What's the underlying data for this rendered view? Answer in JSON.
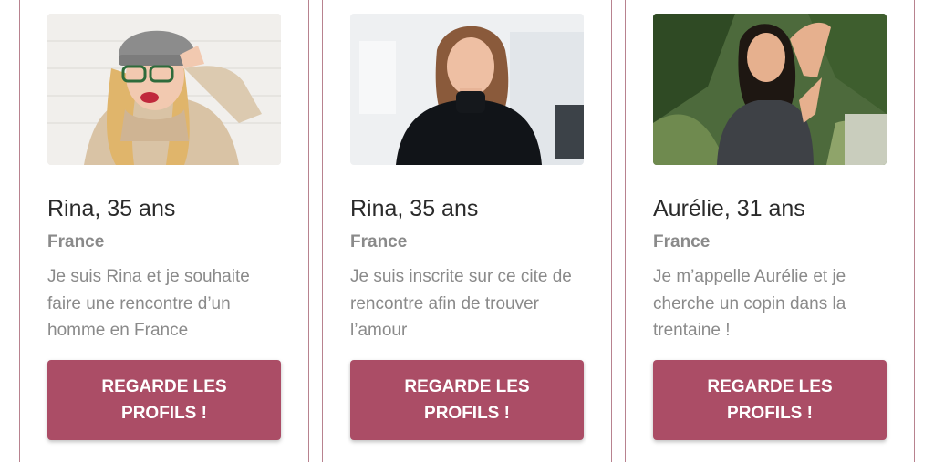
{
  "profiles": [
    {
      "name_age": "Rina, 35 ans",
      "country": "France",
      "description": "Je suis Rina et je souhaite faire une rencontre d’un homme en France",
      "button_label": "REGARDE LES PROFILS !",
      "photo": "woman-beanie-glasses-photo"
    },
    {
      "name_age": "Rina, 35 ans",
      "country": "France",
      "description": "Je suis inscrite sur ce cite de rencontre afin de trouver l’amour",
      "button_label": "REGARDE LES PROFILS !",
      "photo": "woman-black-turtleneck-photo"
    },
    {
      "name_age": "Aurélie, 31 ans",
      "country": "France",
      "description": "Je m’appelle Aurélie et je cherche un copin dans la trentaine !",
      "button_label": "REGARDE LES PROFILS !",
      "photo": "woman-palm-trees-photo"
    }
  ],
  "colors": {
    "button": "#ab4d66",
    "divider": "#b8828f",
    "name_text": "#2a2a2a",
    "muted_text": "#8a8a8a"
  }
}
